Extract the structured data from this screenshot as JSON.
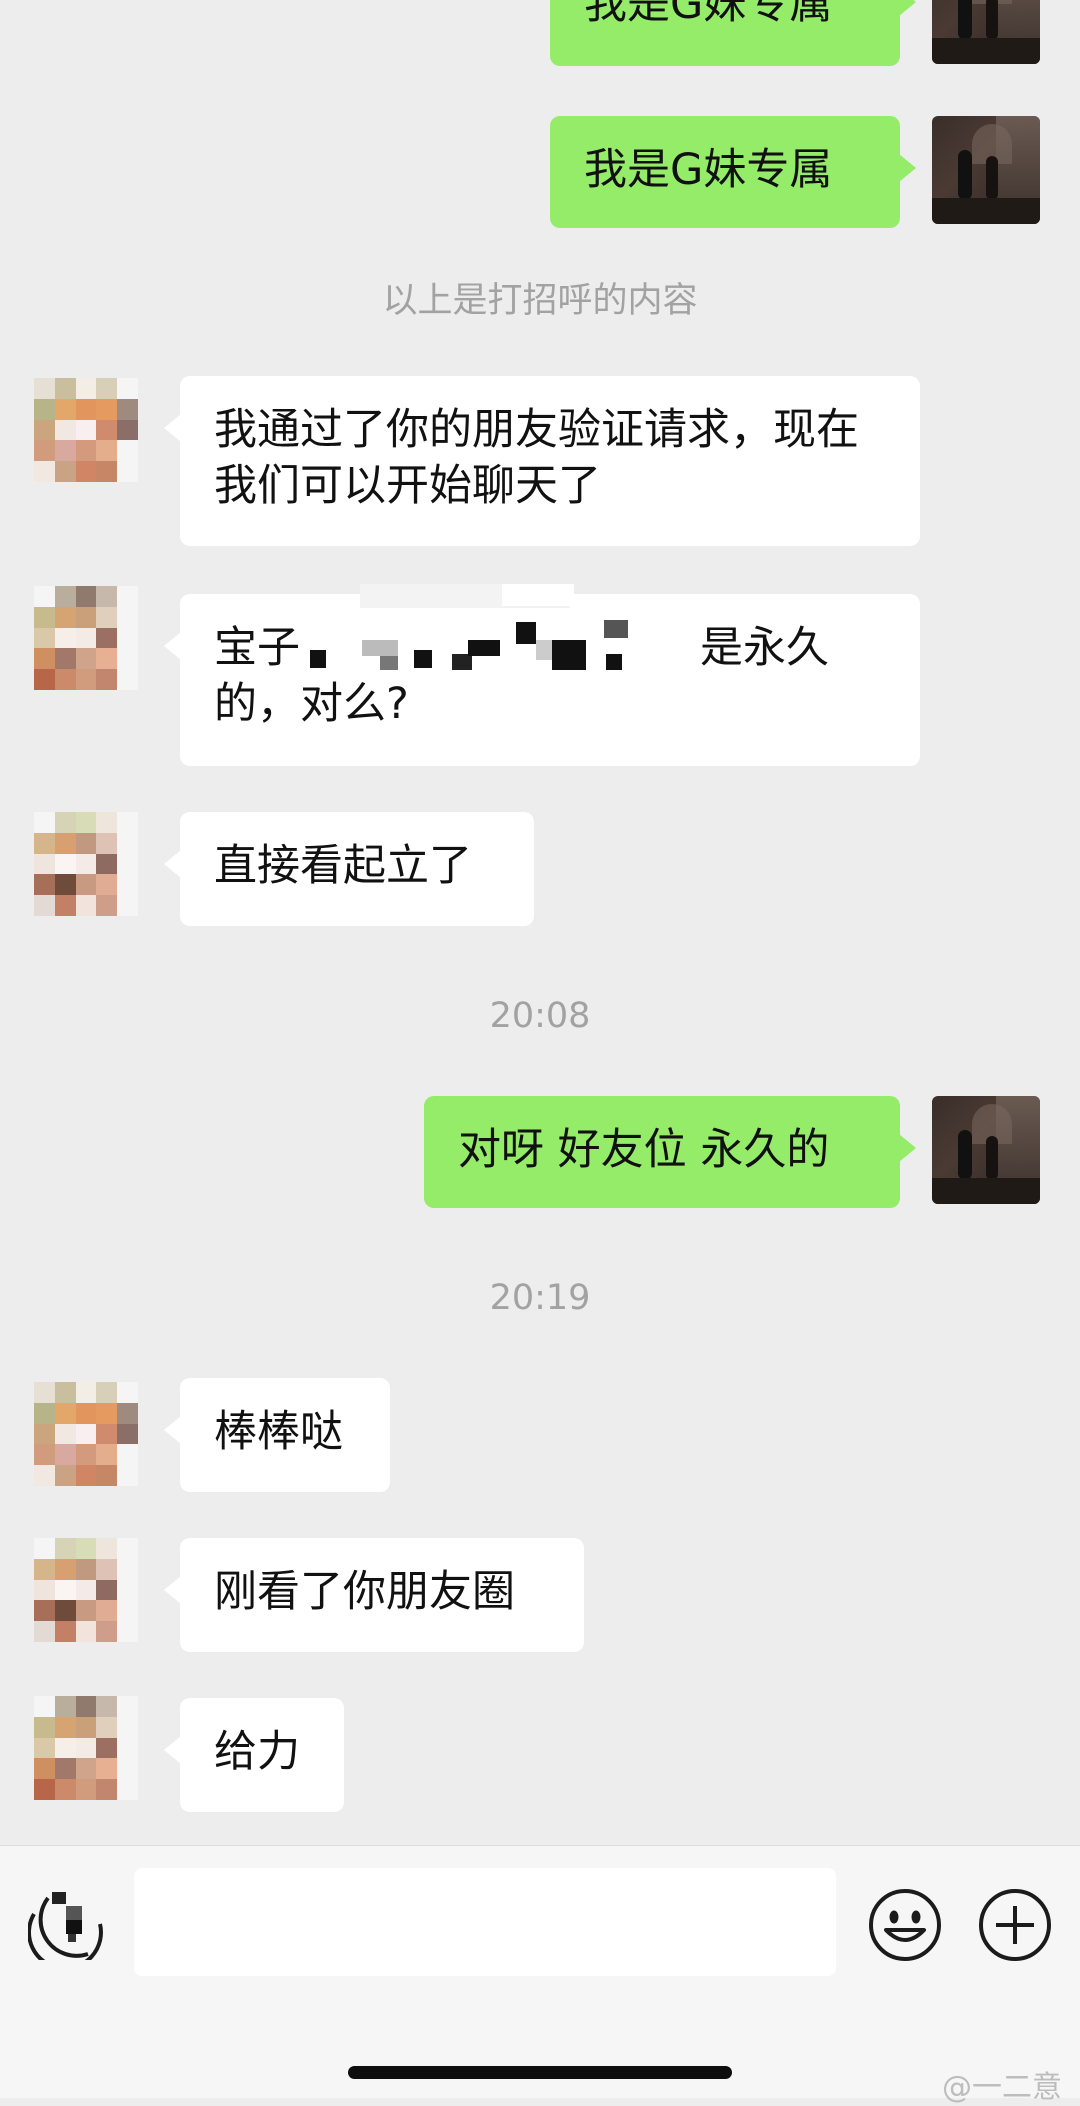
{
  "messages": {
    "out1_top": "我是G妹专属",
    "out2": "我是G妹专属",
    "system_greeting": "以上是打招呼的内容",
    "in1": "我通过了你的朋友验证请求，现在我们可以开始聊天了",
    "in2_prefix": "宝子",
    "in2_suffix": "是永久的，对么?",
    "in3": "直接看起立了",
    "time1": "20:08",
    "out3": "对呀 好友位 永久的",
    "time2": "20:19",
    "in4": "棒棒哒",
    "in5": "刚看了你朋友圈",
    "in6": "给力"
  },
  "inputbar": {
    "voice_icon": "voice-icon",
    "emoji_icon": "emoji-icon",
    "plus_icon": "plus-icon",
    "input_value": ""
  },
  "watermark": "@一二意",
  "colors": {
    "background": "#ededed",
    "bubble_out": "#95ec69",
    "bubble_in": "#ffffff",
    "system_text": "#a2a2a2"
  }
}
